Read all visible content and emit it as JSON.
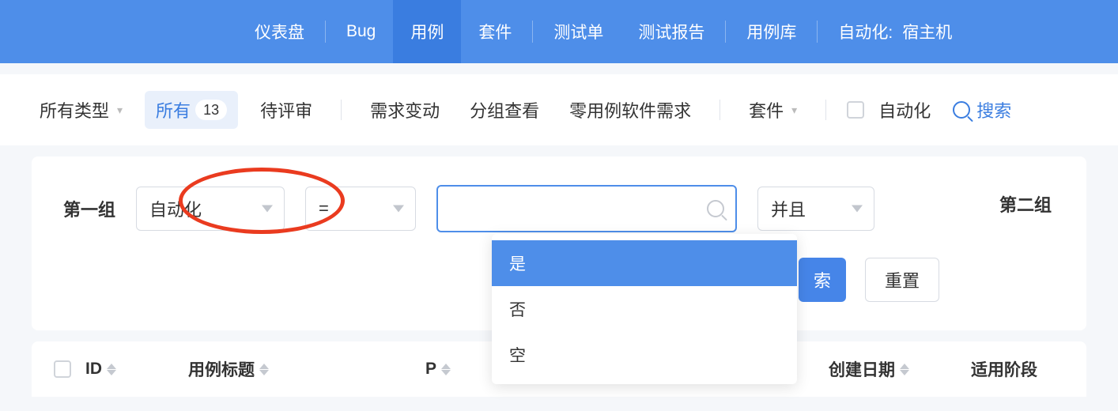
{
  "topnav": {
    "items": [
      {
        "label": "仪表盘"
      },
      {
        "label": "Bug"
      },
      {
        "label": "用例",
        "active": true
      },
      {
        "label": "套件"
      },
      {
        "label": "测试单"
      },
      {
        "label": "测试报告"
      },
      {
        "label": "用例库"
      }
    ],
    "automation_label": "自动化:",
    "host_label": "宿主机"
  },
  "subbar": {
    "all_types": "所有类型",
    "all": "所有",
    "all_count": "13",
    "pending": "待评审",
    "req_change": "需求变动",
    "group_view": "分组查看",
    "zero_req": "零用例软件需求",
    "suite": "套件",
    "automation": "自动化",
    "search": "搜索"
  },
  "filter": {
    "group1": "第一组",
    "field": "自动化",
    "operator": "=",
    "value": "",
    "logic": "并且",
    "group2": "第二组",
    "options": [
      "是",
      "否",
      "空"
    ],
    "search_btn": "索",
    "reset_btn": "重置"
  },
  "table": {
    "cols": {
      "id": "ID",
      "title": "用例标题",
      "p": "P",
      "date": "创建日期",
      "stage": "适用阶段"
    }
  }
}
